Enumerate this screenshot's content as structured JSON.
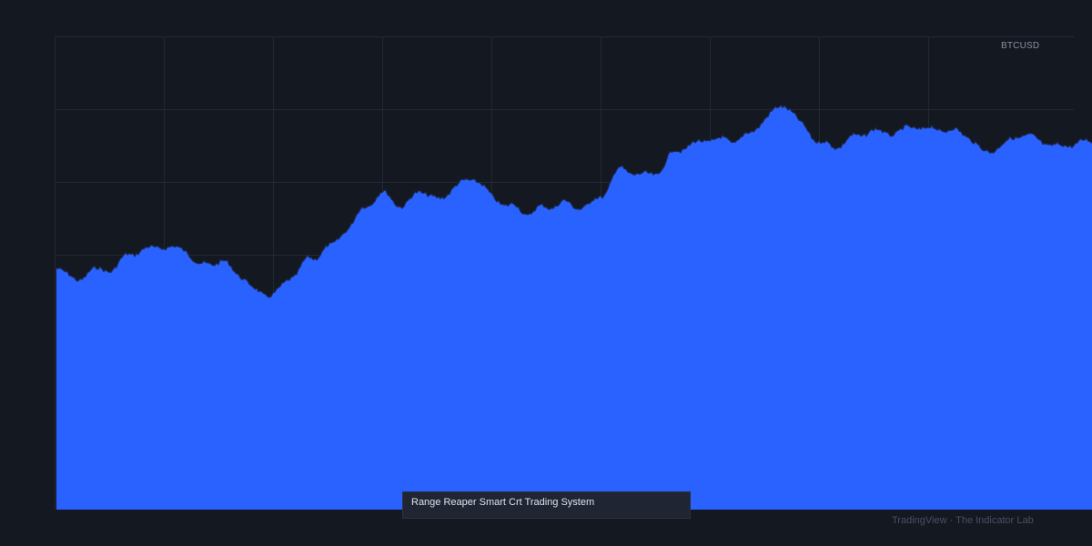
{
  "symbol": "BTCUSD",
  "caption": "Range Reaper Smart Crt Trading System",
  "watermark": "TradingView · The Indicator Lab",
  "colors": {
    "background": "#141821",
    "grid": "#232836",
    "area_fill": "#2962ff",
    "caption_bg": "#1f2532"
  },
  "chart_data": {
    "type": "area",
    "title": "",
    "xlabel": "",
    "ylabel": "",
    "grid": true,
    "legend": "none",
    "series": [
      {
        "name": "BTCUSD",
        "points": [
          [
            0,
            0.7
          ],
          [
            20,
            0.67
          ],
          [
            40,
            0.71
          ],
          [
            60,
            0.71
          ],
          [
            80,
            0.73
          ],
          [
            100,
            0.74
          ],
          [
            120,
            0.76
          ],
          [
            140,
            0.76
          ],
          [
            160,
            0.71
          ],
          [
            180,
            0.71
          ],
          [
            200,
            0.69
          ],
          [
            220,
            0.66
          ],
          [
            240,
            0.65
          ],
          [
            260,
            0.68
          ],
          [
            280,
            0.72
          ],
          [
            300,
            0.76
          ],
          [
            320,
            0.81
          ],
          [
            340,
            0.85
          ],
          [
            360,
            0.87
          ],
          [
            380,
            0.85
          ],
          [
            400,
            0.9
          ],
          [
            420,
            0.87
          ],
          [
            440,
            0.89
          ],
          [
            460,
            0.91
          ],
          [
            480,
            0.88
          ],
          [
            500,
            0.86
          ],
          [
            520,
            0.83
          ],
          [
            540,
            0.84
          ],
          [
            560,
            0.86
          ],
          [
            580,
            0.86
          ],
          [
            600,
            0.88
          ],
          [
            620,
            0.93
          ],
          [
            640,
            0.92
          ],
          [
            660,
            0.94
          ],
          [
            680,
            0.99
          ],
          [
            700,
            0.99
          ],
          [
            720,
            1.0
          ],
          [
            740,
            1.01
          ],
          [
            760,
            1.03
          ],
          [
            780,
            1.06
          ],
          [
            800,
            1.08
          ],
          [
            820,
            1.04
          ],
          [
            840,
            1.01
          ],
          [
            860,
            1.0
          ],
          [
            880,
            1.01
          ],
          [
            900,
            1.02
          ],
          [
            920,
            1.03
          ],
          [
            940,
            1.05
          ],
          [
            960,
            1.03
          ],
          [
            980,
            1.02
          ],
          [
            1000,
            1.02
          ],
          [
            1020,
            0.99
          ],
          [
            1040,
            1.0
          ],
          [
            1060,
            1.01
          ],
          [
            1080,
            1.0
          ],
          [
            1100,
            1.0
          ],
          [
            1120,
            1.01
          ],
          [
            1138,
            1.0
          ]
        ]
      }
    ]
  }
}
